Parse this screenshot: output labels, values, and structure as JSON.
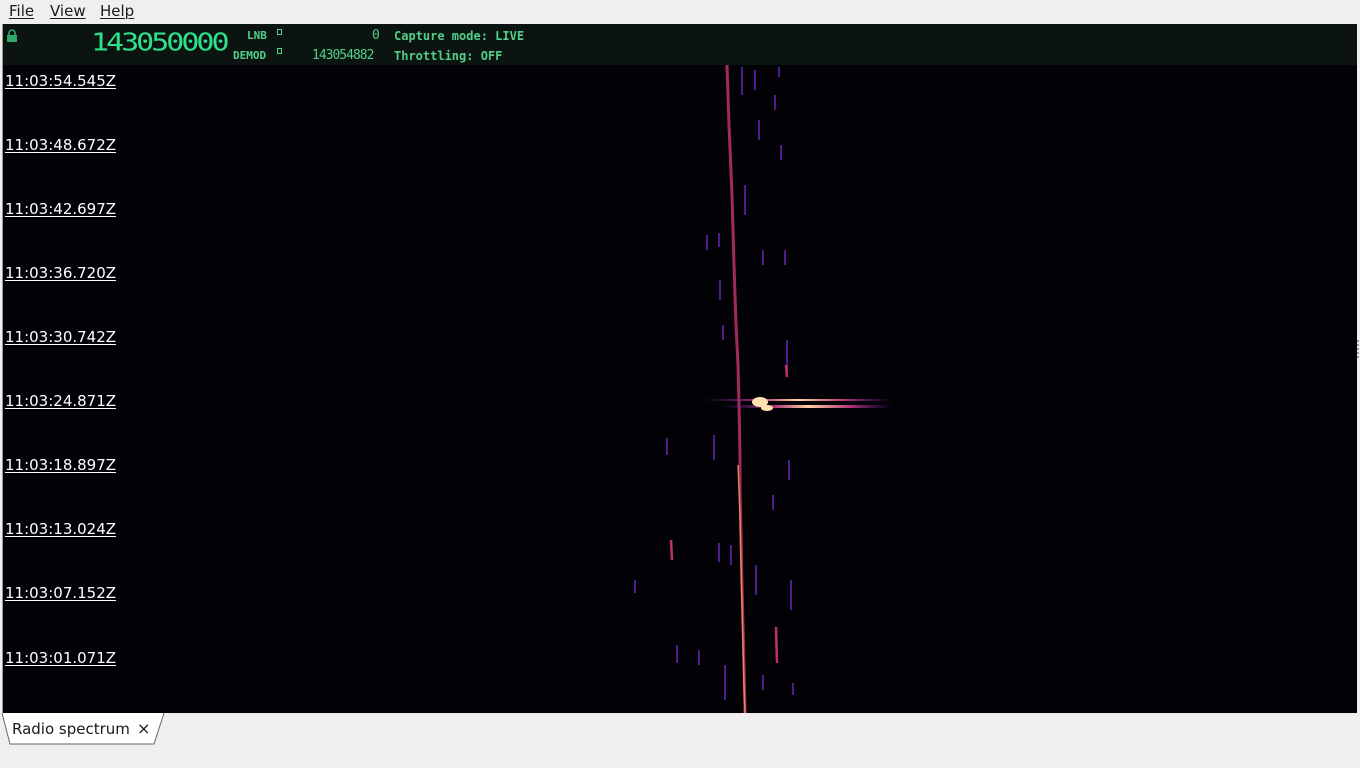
{
  "menu": {
    "file": "File",
    "view": "View",
    "help": "Help"
  },
  "header": {
    "main_frequency": "143050000",
    "lnb_label": "LNB",
    "lnb_value": "0",
    "demod_label": "DEMOD",
    "demod_value": "143054882",
    "capture_mode": "Capture mode: LIVE",
    "throttling": "Throttling: OFF"
  },
  "waterfall": {
    "timestamps": [
      "11:03:54.545Z",
      "11:03:48.672Z",
      "11:03:42.697Z",
      "11:03:36.720Z",
      "11:03:30.742Z",
      "11:03:24.871Z",
      "11:03:18.897Z",
      "11:03:13.024Z",
      "11:03:07.152Z",
      "11:03:01.071Z"
    ]
  },
  "tabs": [
    {
      "label": "Radio spectrum",
      "close": "×"
    }
  ],
  "colors": {
    "header_text": "#52d08a",
    "waterfall_bg": "#020106",
    "signal_hot": "#ffd3a0",
    "signal_mid": "#e0407a",
    "signal_low": "#5a1f9a"
  }
}
